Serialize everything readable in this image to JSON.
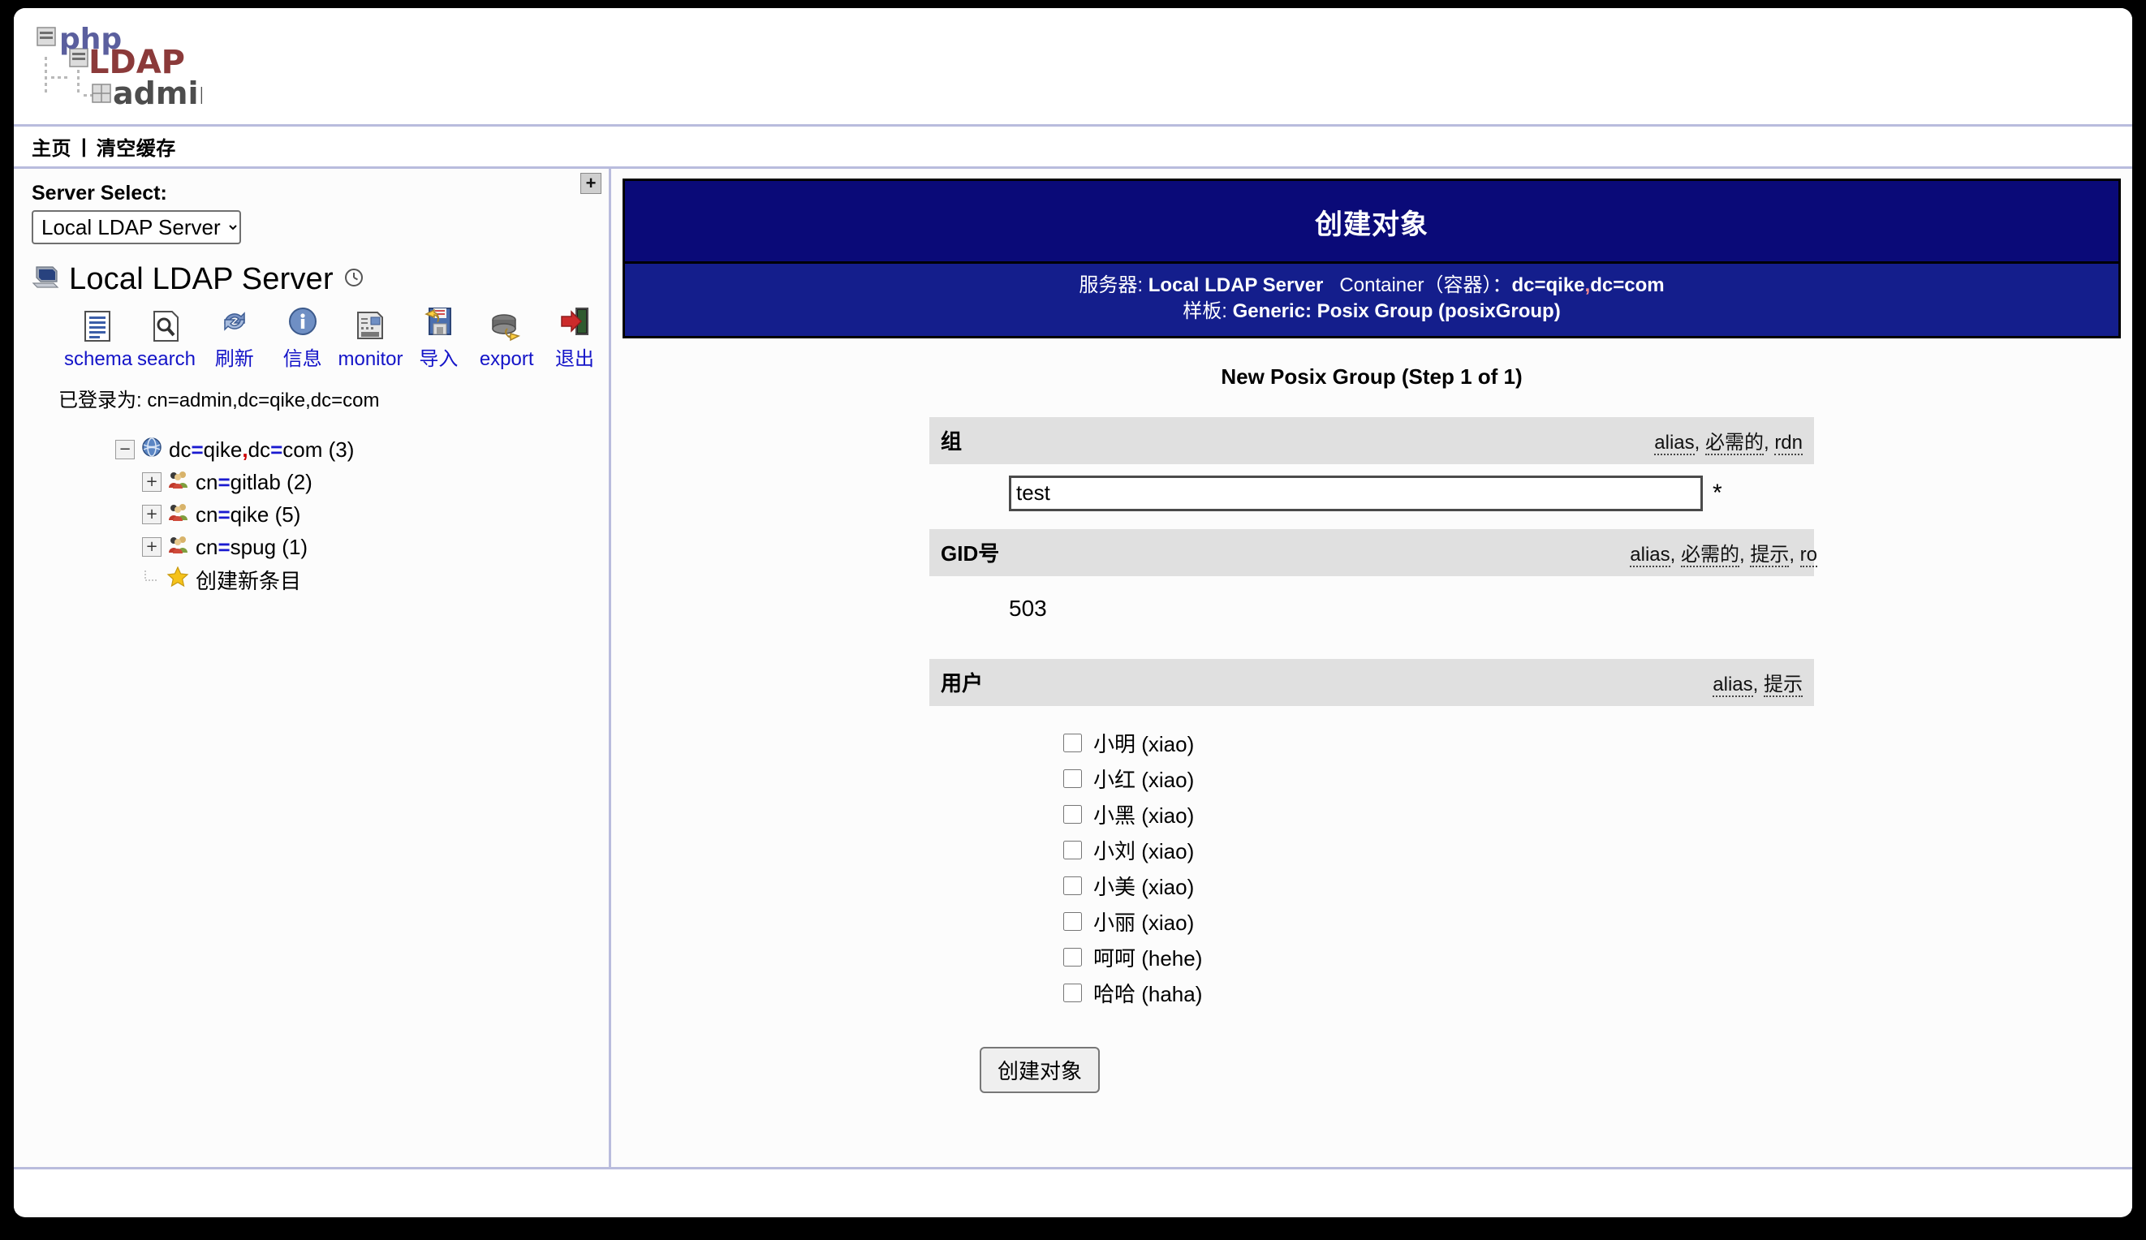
{
  "app": {
    "logo_alt": "phpLDAPadmin",
    "logo_text_php": "php",
    "logo_text_ldap": "LDAP",
    "logo_text_admin": "admin"
  },
  "navbar": {
    "home_label": "主页",
    "separator": "|",
    "purge_cache_label": "清空缓存"
  },
  "sidebar": {
    "collapse_button": "+",
    "server_select_label": "Server Select:",
    "server_select_value": "Local LDAP Server",
    "server_select_options": [
      "Local LDAP Server"
    ],
    "server_name": "Local LDAP Server",
    "toolbar": [
      {
        "label": "schema",
        "icon": "schema-document-icon"
      },
      {
        "label": "search",
        "icon": "search-document-icon"
      },
      {
        "label": "刷新",
        "icon": "refresh-icon"
      },
      {
        "label": "信息",
        "icon": "info-icon"
      },
      {
        "label": "monitor",
        "icon": "monitor-icon"
      },
      {
        "label": "导入",
        "icon": "import-floppy-icon"
      },
      {
        "label": "export",
        "icon": "export-database-icon"
      },
      {
        "label": "退出",
        "icon": "logout-door-icon"
      }
    ],
    "logged_in_label": "已登录为:",
    "logged_in_dn": "cn=admin,dc=qike,dc=com",
    "tree": [
      {
        "toggle": "−",
        "icon": "globe-icon",
        "rdn": "dc=qike,dc=com",
        "count": "(3)",
        "level": 0
      },
      {
        "toggle": "+",
        "icon": "group-users-icon",
        "rdn": "cn=gitlab",
        "count": "(2)",
        "level": 1
      },
      {
        "toggle": "+",
        "icon": "group-users-icon",
        "rdn": "cn=qike",
        "count": "(5)",
        "level": 1
      },
      {
        "toggle": "+",
        "icon": "group-users-icon",
        "rdn": "cn=spug",
        "count": "(1)",
        "level": 1
      },
      {
        "toggle": "",
        "icon": "star-icon",
        "rdn": "创建新条目",
        "count": "",
        "level": 1
      }
    ]
  },
  "main": {
    "header_title": "创建对象",
    "server_prefix": "服务器:",
    "server_value": "Local LDAP Server",
    "container_label": "Container（容器）：",
    "container_value": "dc=qike,dc=com",
    "template_prefix": "样板:",
    "template_value": "Generic: Posix Group (posixGroup)",
    "form_title": "New Posix Group (Step 1 of 1)",
    "fields": [
      {
        "name": "组",
        "hints": [
          "alias",
          "必需的",
          "rdn"
        ],
        "type": "text",
        "value": "test",
        "required_marker": "*"
      },
      {
        "name": "GID号",
        "hints": [
          "alias",
          "必需的",
          "提示",
          "ro"
        ],
        "type": "static",
        "value": "503"
      },
      {
        "name": "用户",
        "hints": [
          "alias",
          "提示"
        ],
        "type": "checkboxes"
      }
    ],
    "members": [
      {
        "label": "小明 (xiao)",
        "checked": false
      },
      {
        "label": "小红 (xiao)",
        "checked": false
      },
      {
        "label": "小黑 (xiao)",
        "checked": false
      },
      {
        "label": "小刘 (xiao)",
        "checked": false
      },
      {
        "label": "小美 (xiao)",
        "checked": false
      },
      {
        "label": "小丽 (xiao)",
        "checked": false
      },
      {
        "label": "呵呵 (hehe)",
        "checked": false
      },
      {
        "label": "哈哈 (haha)",
        "checked": false
      }
    ],
    "submit_label": "创建对象"
  },
  "colors": {
    "header_blue": "#0a0a78",
    "subheader_blue": "#141e8c",
    "link_blue": "#1414c8",
    "bar_grey": "#e0e0e0",
    "divider": "#b9bcdd"
  }
}
